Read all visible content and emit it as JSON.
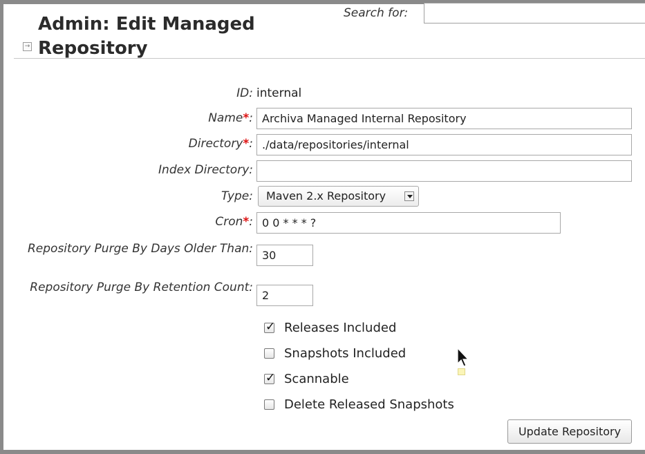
{
  "header": {
    "title": "Admin: Edit Managed Repository",
    "search_label": "Search for:",
    "search_value": ""
  },
  "form": {
    "id_label": "ID:",
    "id_value": "internal",
    "name_label": "Name",
    "name_value": "Archiva Managed Internal Repository",
    "directory_label": "Directory",
    "directory_value": "./data/repositories/internal",
    "index_directory_label": "Index Directory:",
    "index_directory_value": "",
    "type_label": "Type:",
    "type_value": "Maven 2.x Repository",
    "cron_label": "Cron",
    "cron_value": "0 0 * * * ?",
    "purge_days_label": "Repository Purge By Days Older Than:",
    "purge_days_value": "30",
    "purge_count_label": "Repository Purge By Retention Count:",
    "purge_count_value": "2",
    "required_marker": "*",
    "colon": ":"
  },
  "checkboxes": [
    {
      "label": "Releases Included",
      "checked": true
    },
    {
      "label": "Snapshots Included",
      "checked": false
    },
    {
      "label": "Scannable",
      "checked": true
    },
    {
      "label": "Delete Released Snapshots",
      "checked": false
    }
  ],
  "actions": {
    "update_label": "Update Repository"
  },
  "icons": {
    "collapse": "expand-arrow-icon",
    "check": "checkmark-icon",
    "cursor": "mouse-pointer-icon"
  },
  "colors": {
    "required": "#dd1111",
    "frame": "#8a8a8a"
  }
}
